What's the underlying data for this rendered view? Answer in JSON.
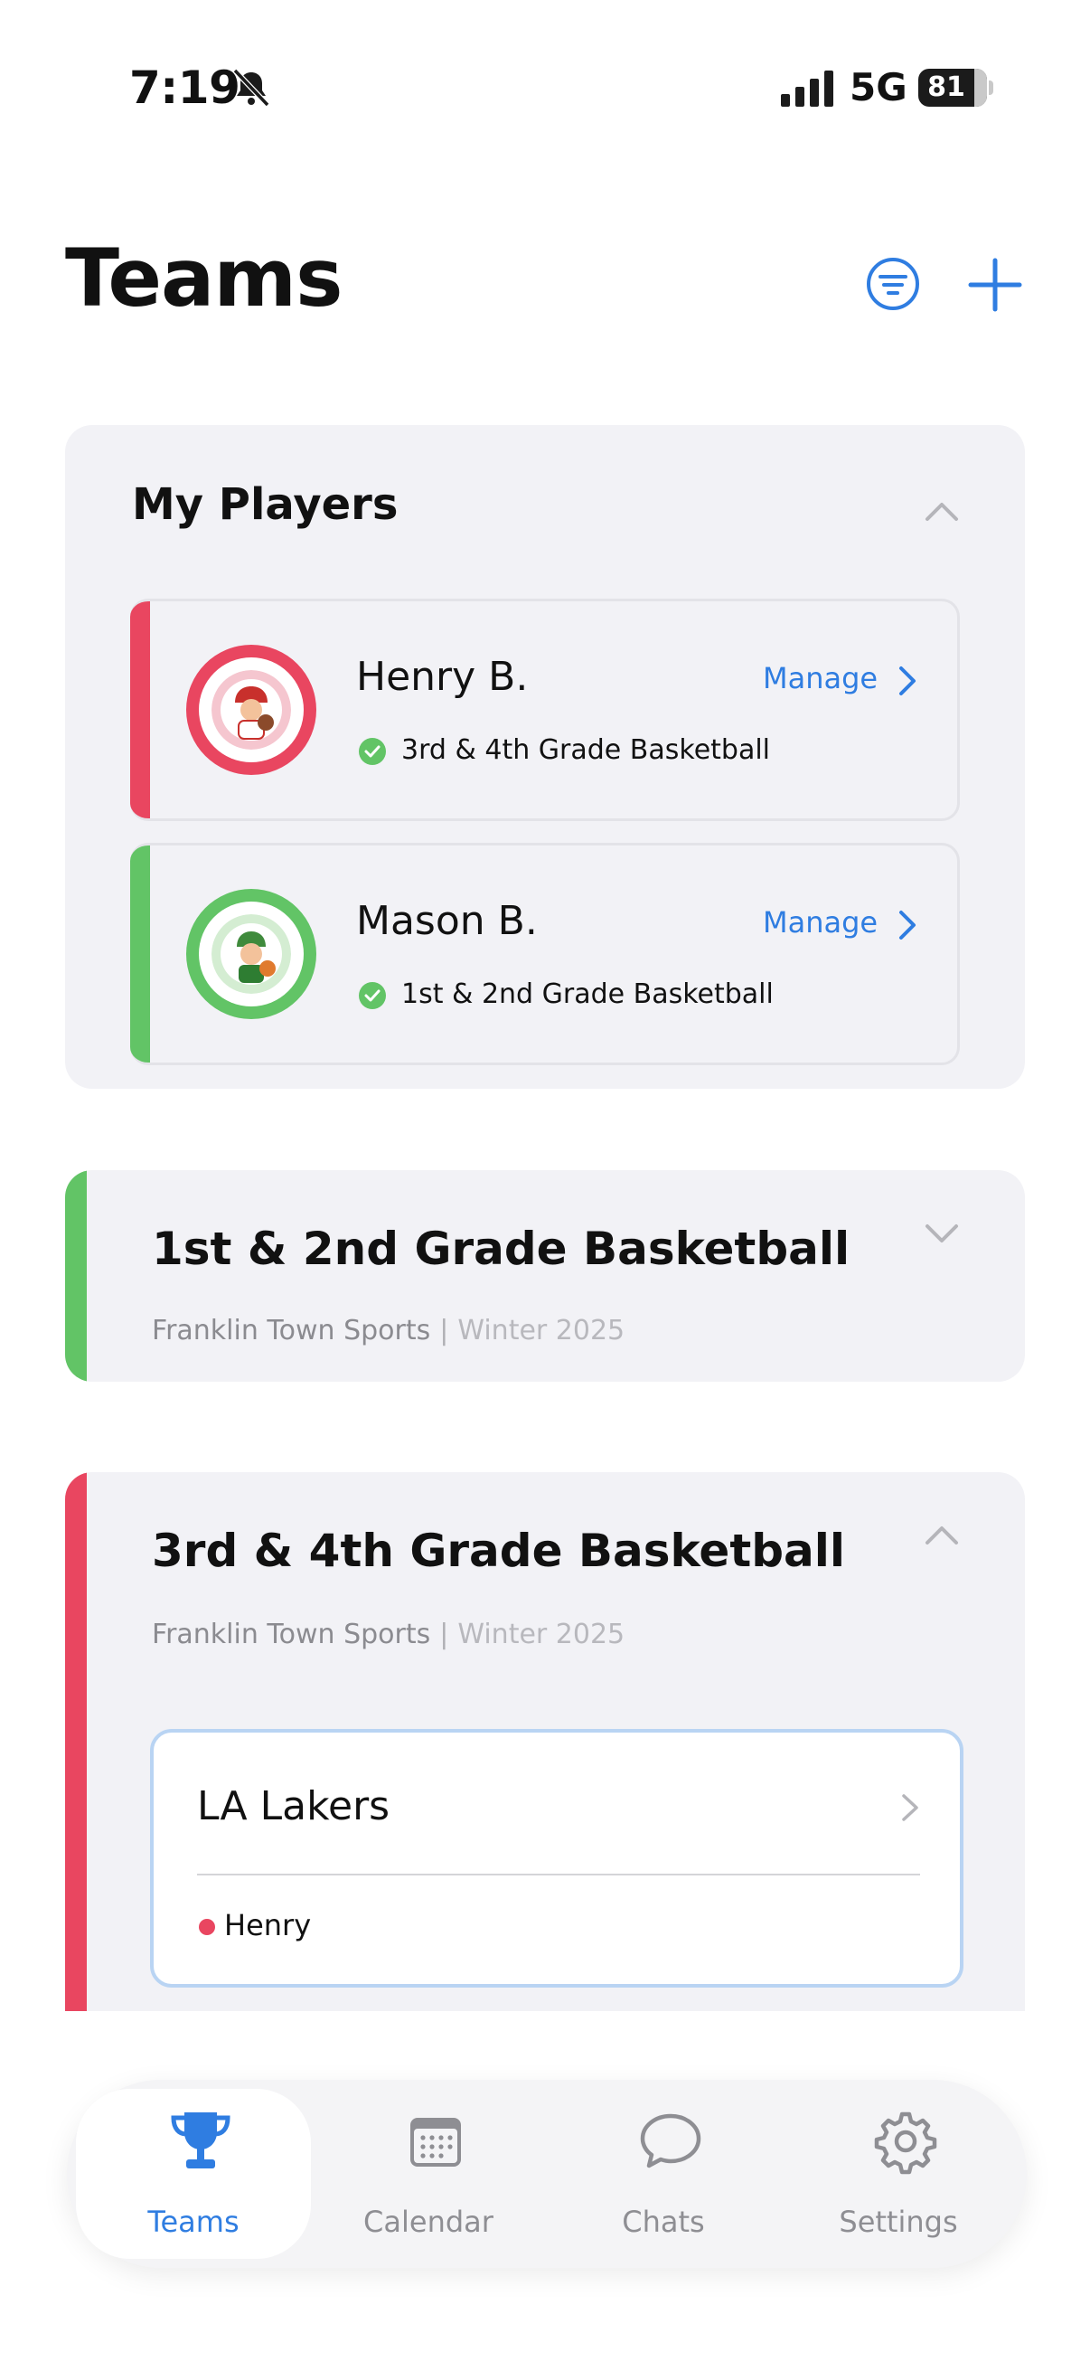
{
  "status_bar": {
    "time": "7:19",
    "network": "5G",
    "battery": "81"
  },
  "header": {
    "title": "Teams"
  },
  "my_players": {
    "title": "My Players",
    "players": [
      {
        "name": "Henry B.",
        "action": "Manage",
        "team": "3rd & 4th Grade Basketball",
        "color": "#e94660"
      },
      {
        "name": "Mason B.",
        "action": "Manage",
        "team": "1st & 2nd Grade Basketball",
        "color": "#62c466"
      }
    ]
  },
  "divisions": [
    {
      "title": "1st & 2nd Grade Basketball",
      "org": "Franklin Town Sports",
      "season": "Winter 2025",
      "color": "#62c466",
      "expanded": false
    },
    {
      "title": "3rd & 4th Grade Basketball",
      "org": "Franklin Town Sports",
      "season": "Winter 2025",
      "color": "#e94660",
      "expanded": true,
      "teams": [
        {
          "name": "LA Lakers",
          "members": [
            "Henry"
          ]
        }
      ]
    }
  ],
  "tab_bar": {
    "tabs": [
      {
        "label": "Teams",
        "icon": "trophy-icon",
        "active": true
      },
      {
        "label": "Calendar",
        "icon": "calendar-icon",
        "active": false
      },
      {
        "label": "Chats",
        "icon": "chat-bubble-icon",
        "active": false
      },
      {
        "label": "Settings",
        "icon": "gear-icon",
        "active": false
      }
    ]
  },
  "colors": {
    "accent": "#2f7de1",
    "card_bg": "#f2f2f6",
    "success": "#62c466"
  }
}
